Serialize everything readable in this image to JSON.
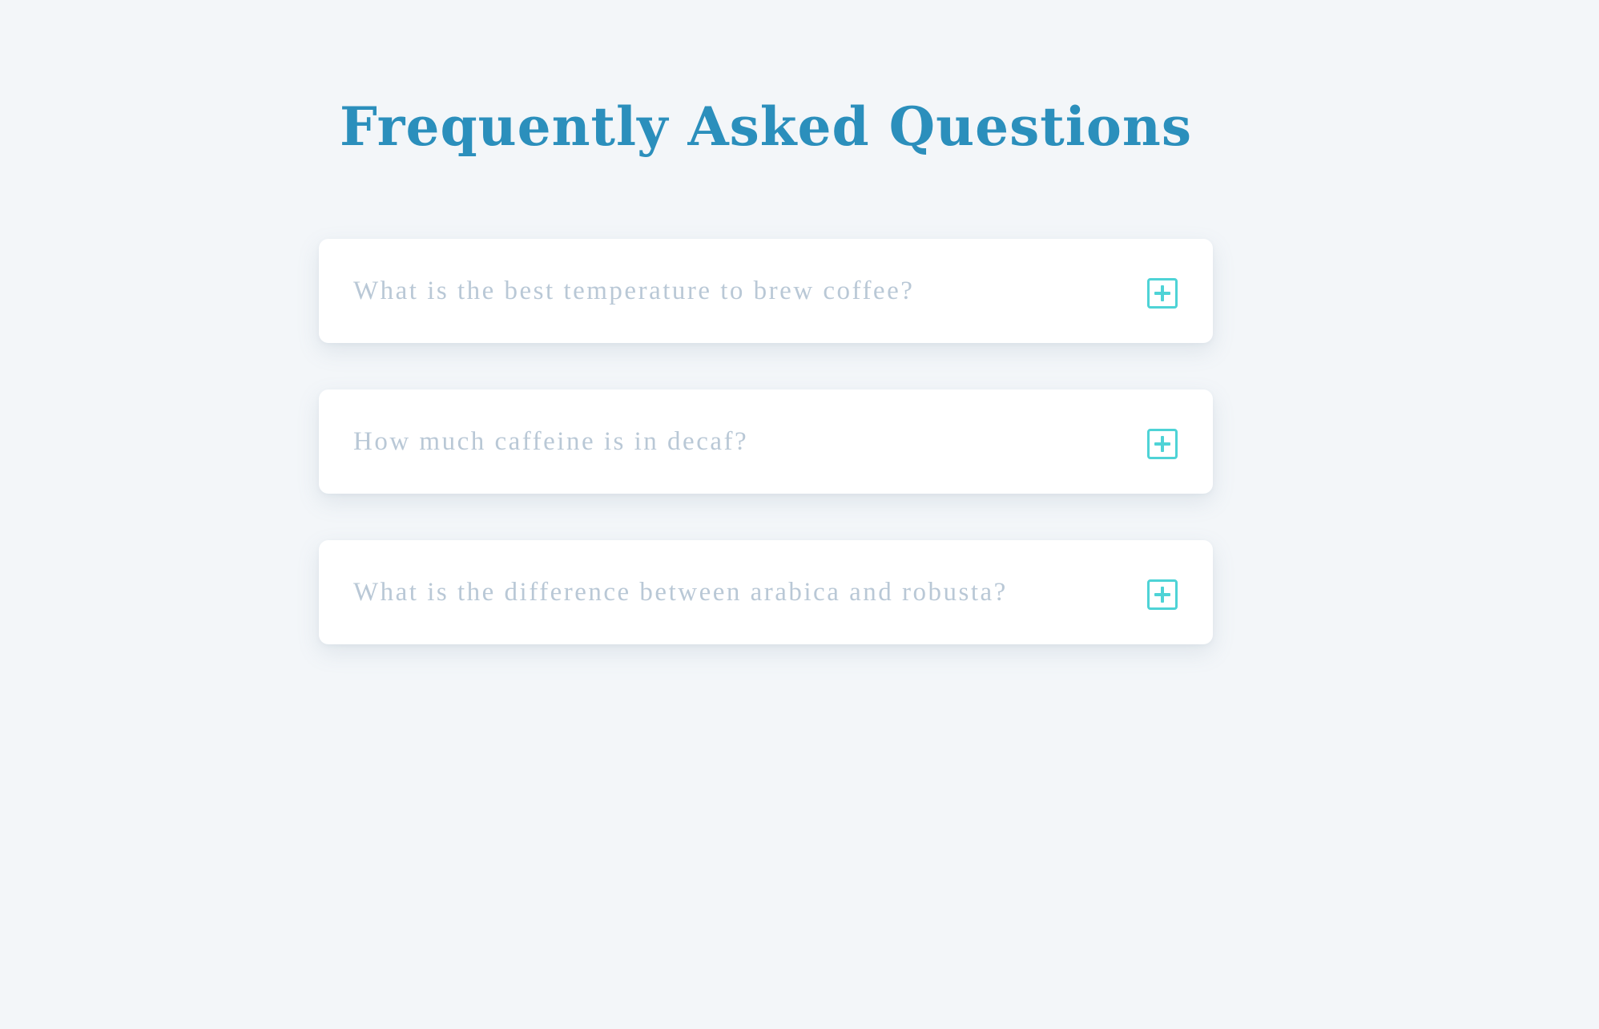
{
  "page": {
    "title": "Frequently Asked Questions"
  },
  "theme": {
    "background": "#f3f6f9",
    "title_color": "#2b8fbc",
    "question_color": "#b9c8d6",
    "icon_color": "#4ed3d6",
    "card_color": "#ffffff"
  },
  "faq": {
    "items": [
      {
        "question": "What is the best temperature to brew coffee?",
        "icon": "plus-square-icon",
        "expanded": false
      },
      {
        "question": "How much caffeine is in decaf?",
        "icon": "plus-square-icon",
        "expanded": false
      },
      {
        "question": "What is the difference between arabica and robusta?",
        "icon": "plus-square-icon",
        "expanded": false
      }
    ]
  }
}
